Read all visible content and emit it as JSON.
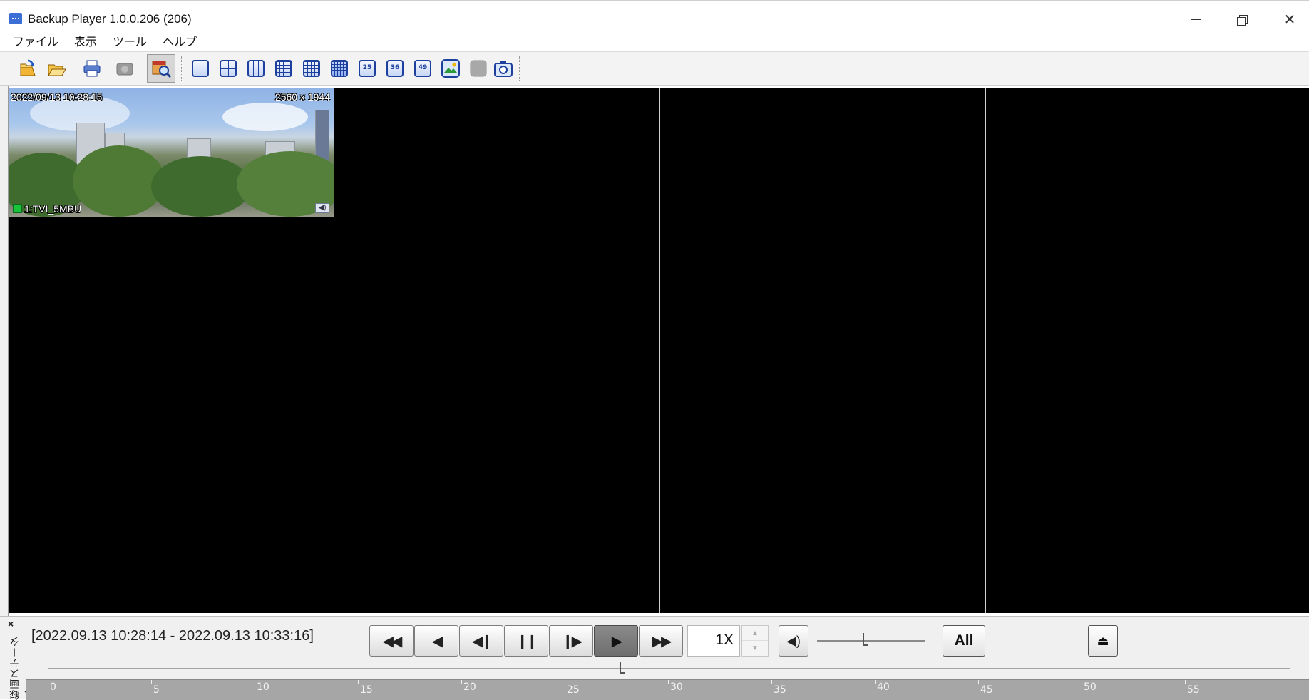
{
  "window": {
    "title": "Backup Player 1.0.0.206 (206)",
    "controls": [
      "minimize",
      "maximize",
      "close"
    ]
  },
  "menu": {
    "items": [
      "ファイル",
      "表示",
      "ツール",
      "ヘルプ"
    ]
  },
  "toolbar": {
    "action_buttons": [
      {
        "name": "open-backup-icon"
      },
      {
        "name": "open-folder-icon"
      },
      {
        "name": "print-icon"
      },
      {
        "name": "disabled-camera-icon"
      },
      {
        "name": "search-icon",
        "pressed": true
      }
    ],
    "layout_buttons": [
      {
        "name": "layout-1-icon",
        "label": ""
      },
      {
        "name": "layout-4-icon",
        "label": ""
      },
      {
        "name": "layout-9-icon",
        "label": ""
      },
      {
        "name": "layout-13-icon",
        "label": ""
      },
      {
        "name": "layout-16-icon",
        "label": ""
      },
      {
        "name": "layout-16b-icon",
        "label": "",
        "active": true
      },
      {
        "name": "layout-25-icon",
        "label": "25"
      },
      {
        "name": "layout-36-icon",
        "label": "36"
      },
      {
        "name": "layout-49-icon",
        "label": "49"
      },
      {
        "name": "image-icon",
        "label": ""
      },
      {
        "name": "disabled-icon",
        "label": ""
      },
      {
        "name": "snapshot-icon",
        "label": ""
      }
    ]
  },
  "video": {
    "grid_rows": 4,
    "grid_cols": 4,
    "camera": {
      "timestamp": "2022/09/13 10:28:15",
      "resolution": "2560 x 1944",
      "name": "1:TVI_5MBU",
      "status_color": "#18c43a"
    }
  },
  "playback": {
    "side_label": "録画ステータス",
    "time_range": "[2022.09.13 10:28:14 - 2022.09.13 10:33:16]",
    "speed": "1X",
    "all_label": "All",
    "buttons": [
      {
        "name": "fast-rewind-button",
        "glyph": "◀◀"
      },
      {
        "name": "rewind-button",
        "glyph": "◀"
      },
      {
        "name": "step-back-button",
        "glyph": "◀❙"
      },
      {
        "name": "pause-button",
        "glyph": "❙❙"
      },
      {
        "name": "step-forward-button",
        "glyph": "❙▶"
      },
      {
        "name": "play-button",
        "glyph": "▶",
        "active": true
      },
      {
        "name": "fast-forward-button",
        "glyph": "▶▶"
      }
    ],
    "volume_level": 0.42,
    "seek_position": 0.46,
    "ruler_ticks": [
      "0",
      "5",
      "10",
      "15",
      "20",
      "25",
      "30",
      "35",
      "40",
      "45",
      "50",
      "55"
    ]
  }
}
